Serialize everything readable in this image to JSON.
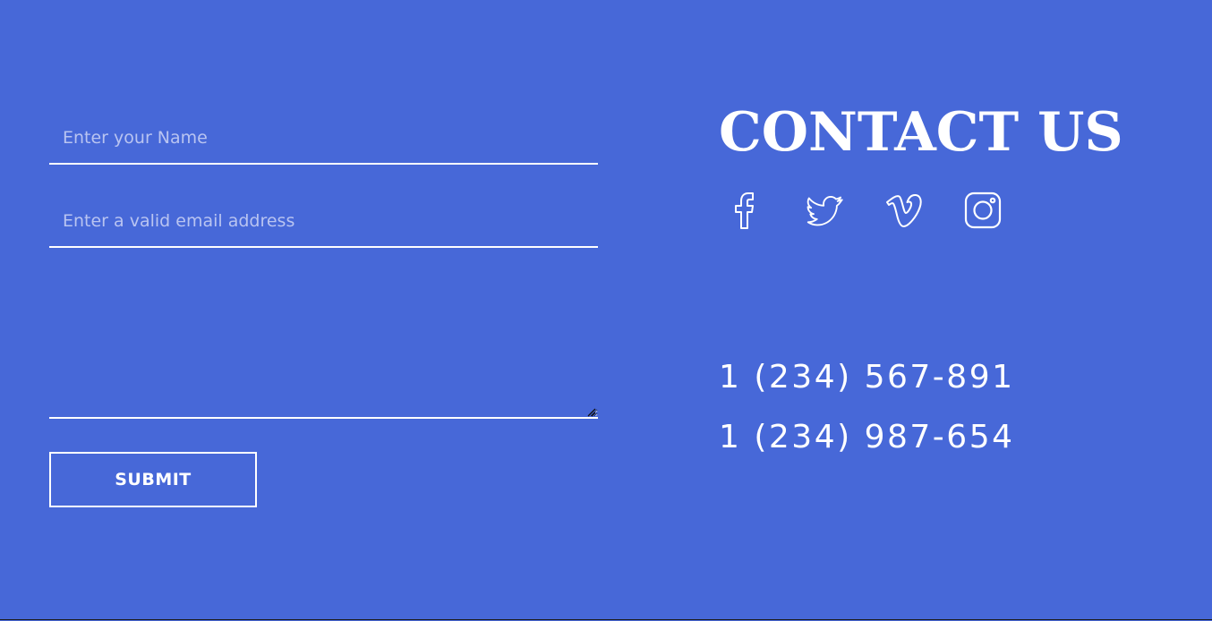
{
  "form": {
    "name_placeholder": "Enter your Name",
    "email_placeholder": "Enter a valid email address",
    "message_placeholder": "",
    "submit_label": "SUBMIT"
  },
  "contact": {
    "title": "CONTACT US",
    "social": [
      {
        "icon": "facebook-icon"
      },
      {
        "icon": "twitter-icon"
      },
      {
        "icon": "vimeo-icon"
      },
      {
        "icon": "instagram-icon"
      }
    ],
    "phones": [
      "1 (234) 567-891",
      "1 (234) 987-654"
    ]
  },
  "colors": {
    "background": "#4768d8",
    "foreground": "#ffffff",
    "placeholder": "#b9c4f1"
  }
}
